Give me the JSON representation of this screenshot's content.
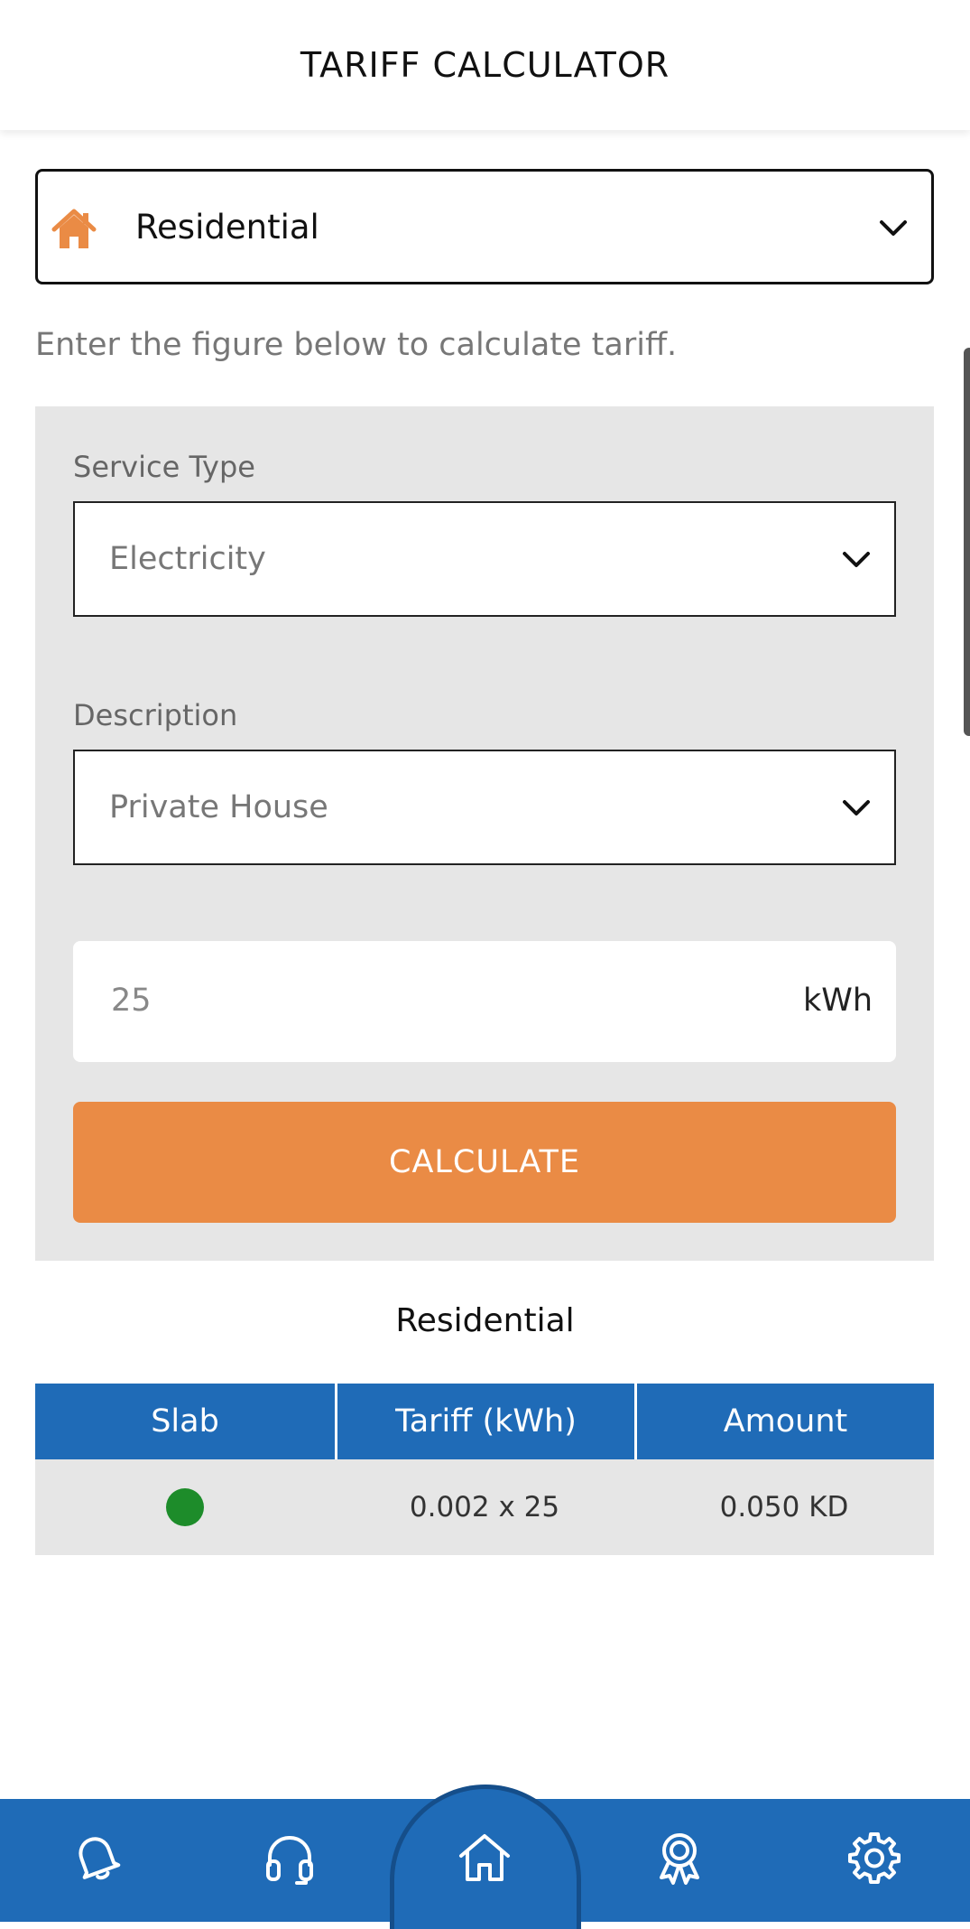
{
  "header": {
    "title": "TARIFF CALCULATOR"
  },
  "category": {
    "value": "Residential",
    "icon": "house-icon",
    "icon_color": "#ea8b45"
  },
  "helper_text": "Enter the figure below to calculate tariff.",
  "form": {
    "service_type": {
      "label": "Service Type",
      "value": "Electricity"
    },
    "description": {
      "label": "Description",
      "value": "Private House"
    },
    "quantity": {
      "value": "25",
      "unit": "kWh"
    },
    "calculate_label": "CALCULATE"
  },
  "result": {
    "title": "Residential",
    "columns": [
      "Slab",
      "Tariff (kWh)",
      "Amount"
    ],
    "rows": [
      {
        "slab_color": "#1d8c2a",
        "tariff": "0.002 x 25",
        "amount": "0.050 KD"
      }
    ]
  },
  "bottom_nav": {
    "items": [
      "bell-icon",
      "headset-icon",
      "home-icon",
      "award-icon",
      "gear-icon"
    ],
    "active": "home-icon"
  },
  "colors": {
    "primary": "#1f6bb7",
    "accent": "#ea8b45",
    "panel": "#e6e6e6"
  }
}
